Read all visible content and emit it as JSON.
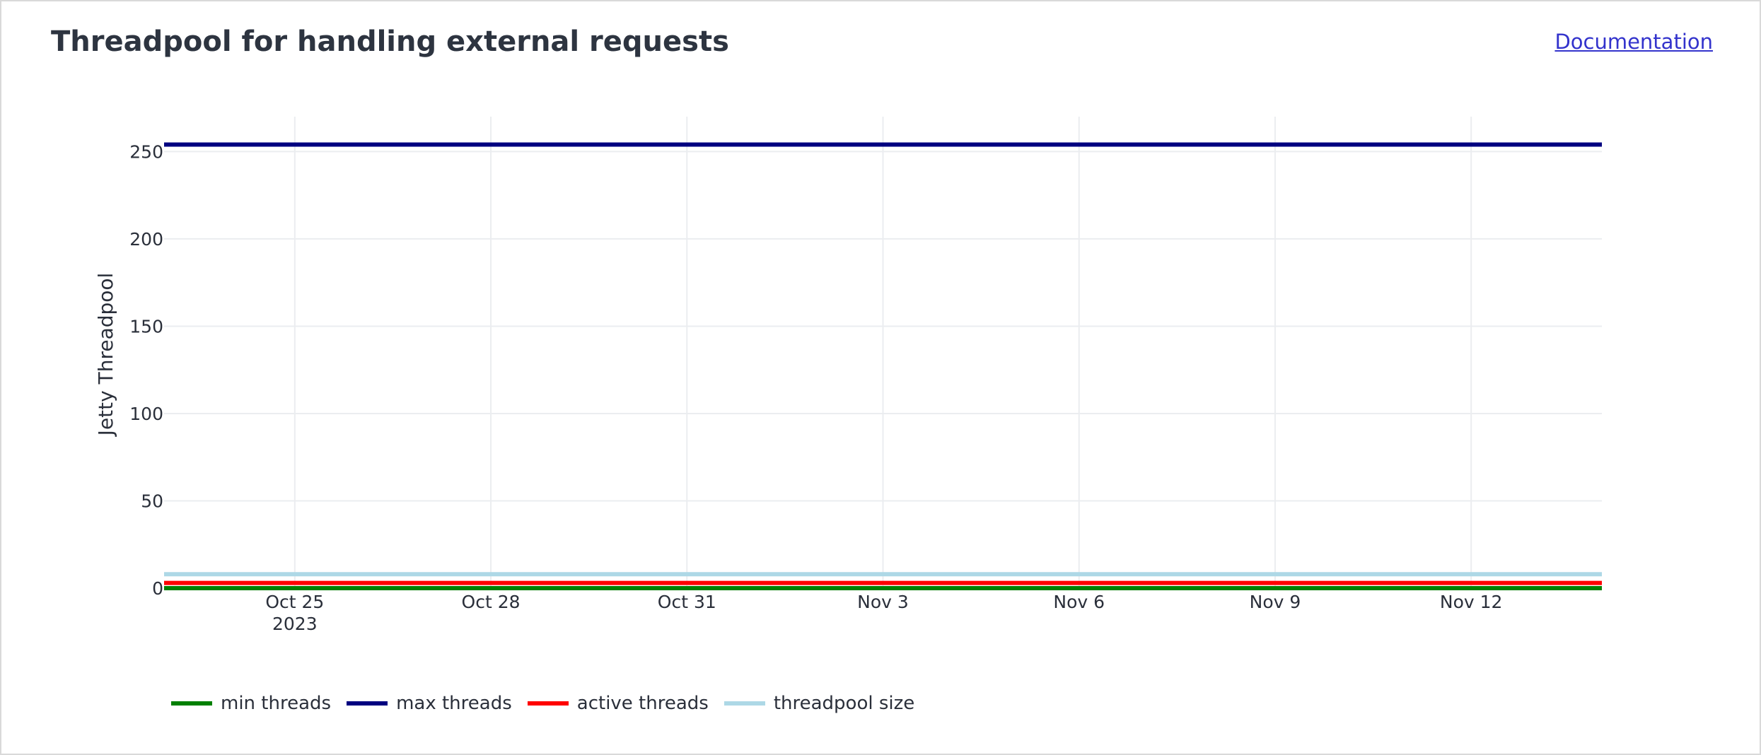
{
  "panel": {
    "title": "Threadpool for handling external requests",
    "doc_link": "Documentation"
  },
  "chart_data": {
    "type": "line",
    "ylabel": "Jetty Threadpool",
    "xlabel": "",
    "ylim": [
      0,
      270
    ],
    "xlim": [
      "2023-10-23",
      "2023-11-14"
    ],
    "x_ticks": [
      {
        "date": "2023-10-25",
        "label": "Oct 25",
        "sublabel": "2023"
      },
      {
        "date": "2023-10-28",
        "label": "Oct 28",
        "sublabel": ""
      },
      {
        "date": "2023-10-31",
        "label": "Oct 31",
        "sublabel": ""
      },
      {
        "date": "2023-11-03",
        "label": "Nov 3",
        "sublabel": ""
      },
      {
        "date": "2023-11-06",
        "label": "Nov 6",
        "sublabel": ""
      },
      {
        "date": "2023-11-09",
        "label": "Nov 9",
        "sublabel": ""
      },
      {
        "date": "2023-11-12",
        "label": "Nov 12",
        "sublabel": ""
      }
    ],
    "y_ticks": [
      0,
      50,
      100,
      150,
      200,
      250
    ],
    "grid": true,
    "legend_position": "bottom-left",
    "x": [
      "2023-10-23",
      "2023-11-14"
    ],
    "series": [
      {
        "name": "min threads",
        "color": "#008000",
        "values": [
          0,
          0
        ]
      },
      {
        "name": "max threads",
        "color": "#000080",
        "values": [
          254,
          254
        ]
      },
      {
        "name": "active threads",
        "color": "#ff0000",
        "values": [
          3,
          3
        ]
      },
      {
        "name": "threadpool size",
        "color": "#add8e6",
        "values": [
          8,
          8
        ]
      }
    ]
  }
}
